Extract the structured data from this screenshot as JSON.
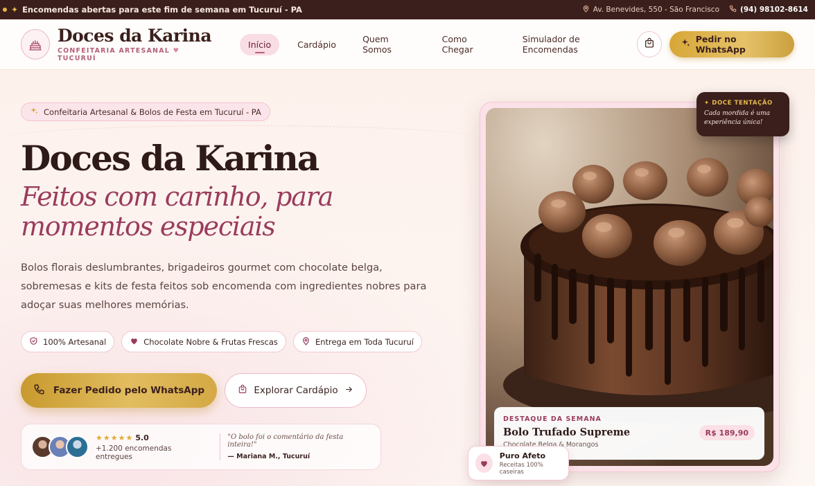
{
  "topbar": {
    "announcement": "Encomendas abertas para este fim de semana em Tucuruí - PA",
    "address": "Av. Benevides, 550 - São Francisco",
    "phone": "(94) 98102-8614"
  },
  "brand": {
    "name": "Doces da Karina",
    "tagline_left": "CONFEITARIA ARTESANAL",
    "tagline_right": "TUCURUÍ"
  },
  "nav": {
    "items": [
      {
        "label": "Início",
        "active": true
      },
      {
        "label": "Cardápio"
      },
      {
        "label": "Quem Somos"
      },
      {
        "label": "Como Chegar"
      },
      {
        "label": "Simulador de Encomendas"
      }
    ]
  },
  "header": {
    "whatsapp_label": "Pedir no WhatsApp"
  },
  "hero": {
    "tag": "Confeitaria Artesanal & Bolos de Festa em Tucuruí - PA",
    "title": "Doces da Karina",
    "subtitle_line1": "Feitos com carinho, para",
    "subtitle_line2": "momentos especiais",
    "description": "Bolos florais deslumbrantes, brigadeiros gourmet com chocolate belga, sobremesas e kits de festa feitos sob encomenda com ingredientes nobres para adoçar suas melhores memórias.",
    "chips": [
      {
        "label": "100% Artesanal",
        "icon": "shield-check-icon"
      },
      {
        "label": "Chocolate Nobre & Frutas Frescas",
        "icon": "heart-icon"
      },
      {
        "label": "Entrega em Toda Tucuruí",
        "icon": "map-pin-icon"
      }
    ],
    "cta_primary": "Fazer Pedido pelo WhatsApp",
    "cta_secondary": "Explorar Cardápio"
  },
  "social_proof": {
    "rating": "5.0",
    "orders": "+1.200 encomendas entregues",
    "quote": "\"O bolo foi o comentário da festa inteira!\"",
    "author": "— Mariana M., Tucuruí"
  },
  "showcase": {
    "badge_kicker": "DOCE TENTAÇÃO",
    "badge_text": "Cada mordida é uma experiência única!",
    "feature_kicker": "DESTAQUE DA SEMANA",
    "feature_title": "Bolo Trufado Supreme",
    "feature_sub": "Chocolate Belga & Morangos",
    "price": "R$ 189,90",
    "afeto_title": "Puro Afeto",
    "afeto_sub": "Receitas 100% caseiras"
  },
  "colors": {
    "topbar": "#3b1f1c",
    "accent_gold": "#d7a637",
    "accent_rose": "#9a3c5e",
    "nav_active_bg": "#f8dde4"
  }
}
